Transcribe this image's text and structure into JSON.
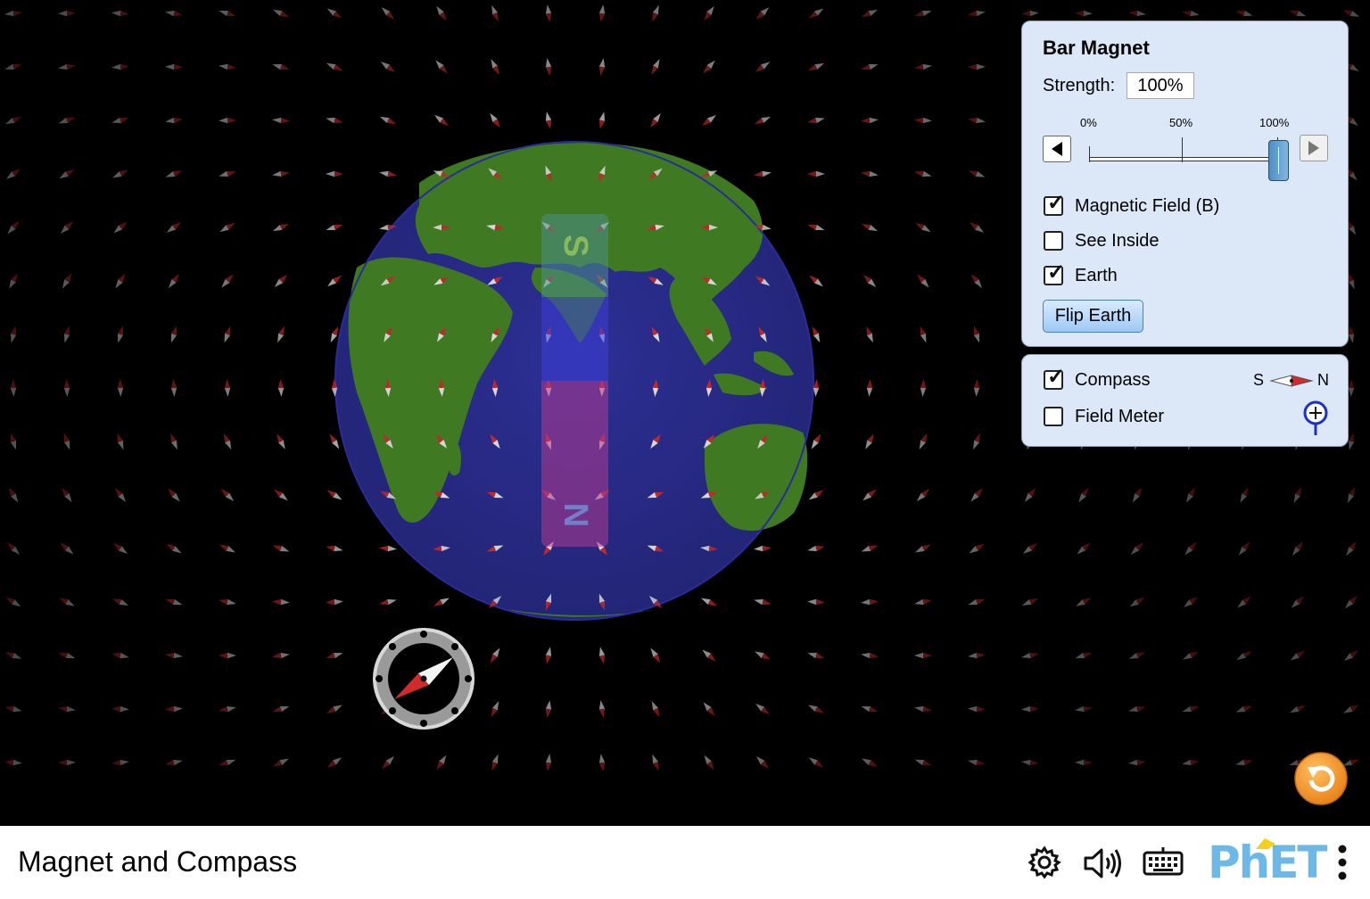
{
  "simulation": {
    "title": "Magnet and Compass"
  },
  "magnet": {
    "south_label": "S",
    "north_label": "N"
  },
  "bar_magnet_panel": {
    "title": "Bar Magnet",
    "strength_label": "Strength:",
    "strength_value": "100%",
    "slider": {
      "tick_labels": [
        "0%",
        "50%",
        "100%"
      ],
      "value_fraction": 1.0
    },
    "checkboxes": {
      "magnetic_field": {
        "label": "Magnetic Field (B)",
        "checked": true
      },
      "see_inside": {
        "label": "See Inside",
        "checked": false
      },
      "earth": {
        "label": "Earth",
        "checked": true
      }
    },
    "flip_button_label": "Flip Earth"
  },
  "tools_panel": {
    "compass": {
      "label": "Compass",
      "checked": true,
      "legend_s": "S",
      "legend_n": "N"
    },
    "field_meter": {
      "label": "Field Meter",
      "checked": false
    }
  },
  "navbar": {
    "icons": [
      "settings-icon",
      "sound-icon",
      "keyboard-icon",
      "phet-logo",
      "menu-icon"
    ],
    "logo_text": "PhET"
  },
  "colors": {
    "background": "#000000",
    "panel": "#dce8f8",
    "ocean": "#2b2e8c",
    "land": "#3f7a22",
    "needle_north": "#c0282a",
    "needle_south": "#e8e8e8",
    "reset_orange": "#f39c28",
    "phet_blue": "#6cb8e6",
    "phet_yellow": "#f4d01d"
  }
}
